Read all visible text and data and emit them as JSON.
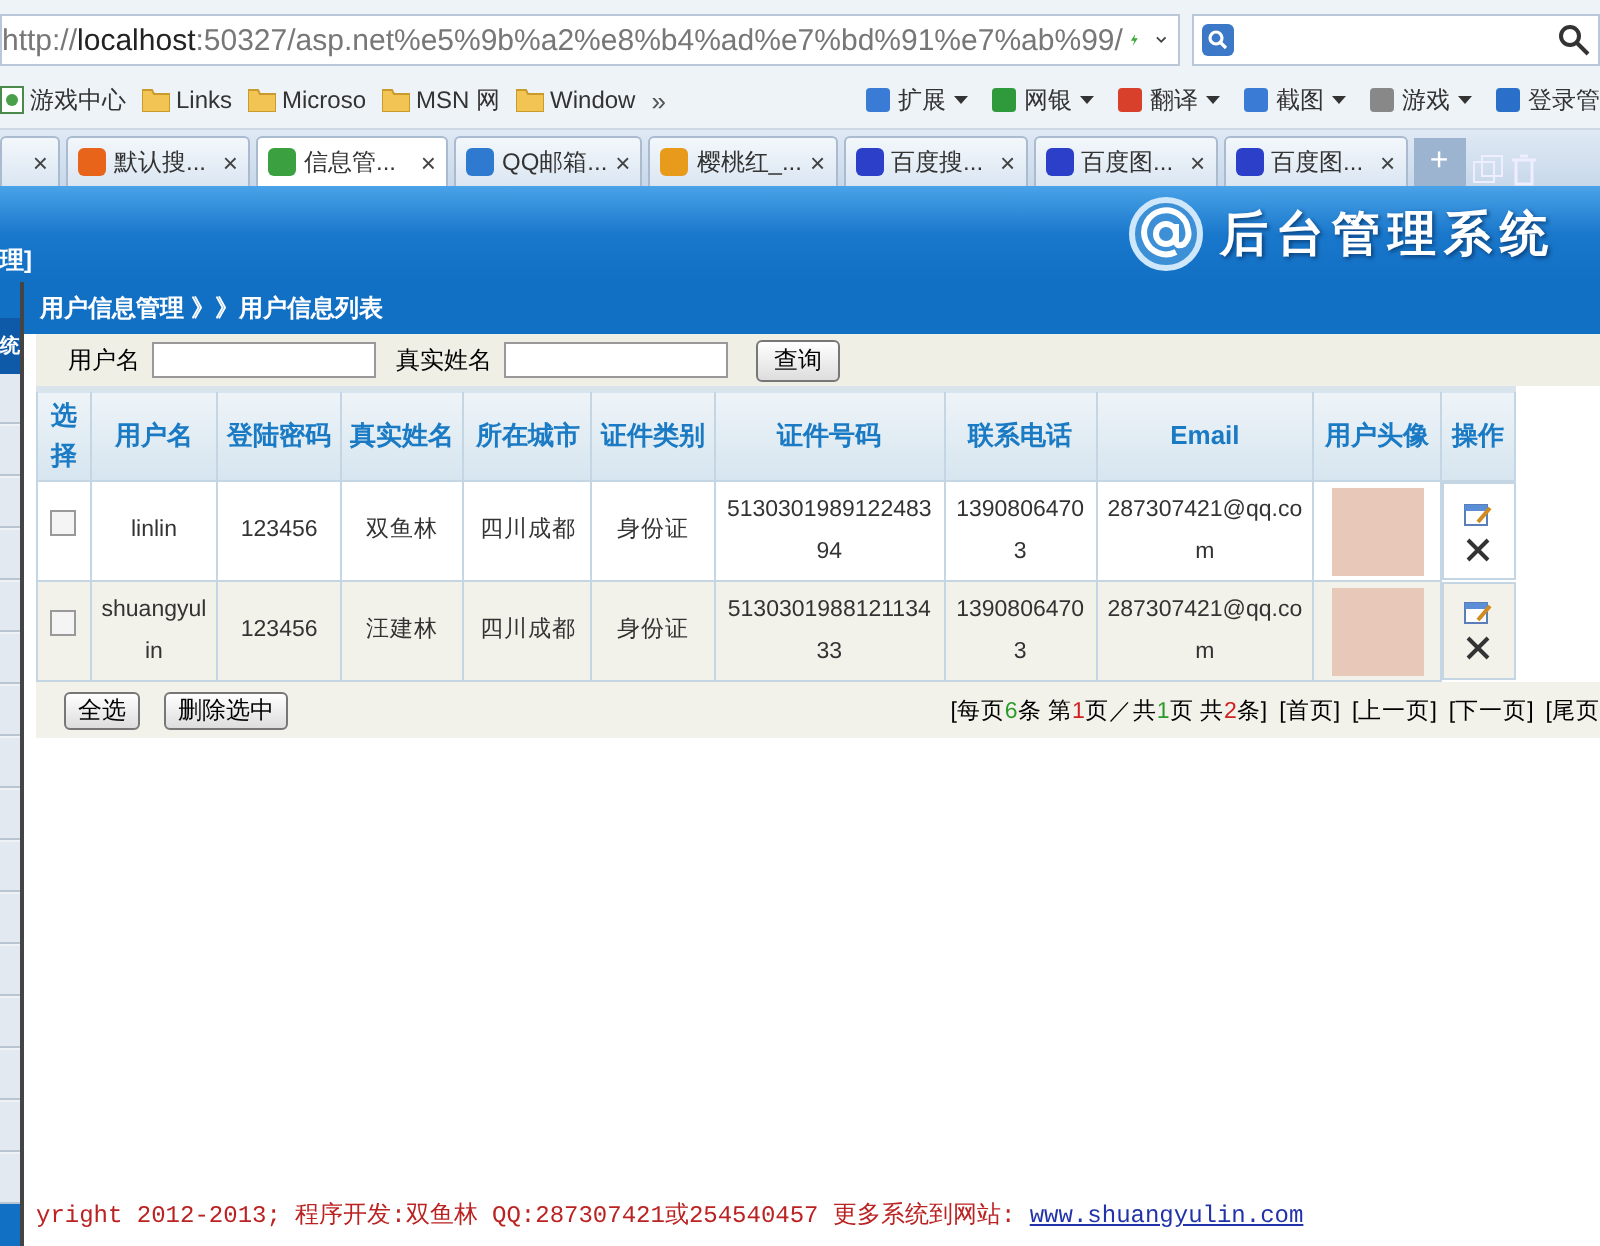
{
  "browser": {
    "address": {
      "scheme": "http://",
      "host": "localhost",
      "rest": ":50327/asp.net%e5%9b%a2%e8%b4%ad%e7%bd%91%e7%ab%99/"
    },
    "bookmarks": [
      {
        "label": "游戏中心",
        "kind": "page"
      },
      {
        "label": "Links",
        "kind": "folder"
      },
      {
        "label": "Microso",
        "kind": "folder"
      },
      {
        "label": "MSN 网",
        "kind": "folder"
      },
      {
        "label": "Window",
        "kind": "folder"
      }
    ],
    "more": "»",
    "tools": [
      {
        "label": "扩展",
        "color": "#3a7bd5"
      },
      {
        "label": "网银",
        "color": "#2e9a3c"
      },
      {
        "label": "翻译",
        "color": "#d9402b"
      },
      {
        "label": "截图",
        "color": "#3a7bd5"
      },
      {
        "label": "游戏",
        "color": "#888888"
      },
      {
        "label": "登录管",
        "color": "#2a6fc9"
      }
    ],
    "tabs": [
      {
        "close": "×",
        "selected": false
      },
      {
        "label": "默认搜...",
        "close": "×",
        "selected": false,
        "color": "#e8641b"
      },
      {
        "label": "信息管...",
        "close": "×",
        "selected": true,
        "color": "#3aa040"
      },
      {
        "label": "QQ邮箱...",
        "close": "×",
        "selected": false,
        "color": "#2e7ad1"
      },
      {
        "label": "樱桃红_...",
        "close": "×",
        "selected": false,
        "color": "#e89b1b"
      },
      {
        "label": "百度搜...",
        "close": "×",
        "selected": false,
        "color": "#2b3fc9"
      },
      {
        "label": "百度图...",
        "close": "×",
        "selected": false,
        "color": "#2b3fc9"
      },
      {
        "label": "百度图...",
        "close": "×",
        "selected": false,
        "color": "#2b3fc9"
      }
    ],
    "new_tab": "+"
  },
  "app": {
    "title": "后台管理系统",
    "side_top": "理]",
    "side_title": "统",
    "breadcrumb": "用户信息管理 》》用户信息列表",
    "search": {
      "fields": [
        {
          "label": "用户名"
        },
        {
          "label": "真实姓名"
        }
      ],
      "button": "查询"
    },
    "table": {
      "columns": [
        "选择",
        "用户名",
        "登陆密码",
        "真实姓名",
        "所在城市",
        "证件类别",
        "证件号码",
        "联系电话",
        "Email",
        "用户头像",
        "操作"
      ],
      "rows": [
        {
          "checked": false,
          "cells": [
            "",
            "linlin",
            "123456",
            "双鱼林",
            "四川成都",
            "身份证",
            "513030198912248394",
            "13908064703",
            "287307421@qq.com"
          ]
        },
        {
          "checked": false,
          "cells": [
            "",
            "shuangyulin",
            "123456",
            "汪建林",
            "四川成都",
            "身份证",
            "513030198812113433",
            "13908064703",
            "287307421@qq.com"
          ]
        }
      ]
    },
    "actions": [
      "全选",
      "删除选中"
    ],
    "pager": {
      "info": [
        {
          "text": "[每页",
          "kind": "plain"
        },
        {
          "text": "6",
          "kind": "green"
        },
        {
          "text": "条 第",
          "kind": "plain"
        },
        {
          "text": "1",
          "kind": "red"
        },
        {
          "text": "页／共",
          "kind": "plain"
        },
        {
          "text": "1",
          "kind": "green"
        },
        {
          "text": "页 共",
          "kind": "plain"
        },
        {
          "text": "2",
          "kind": "red"
        },
        {
          "text": "条]",
          "kind": "plain"
        }
      ],
      "links": [
        "[首页]",
        "[上一页]",
        "[下一页]",
        "[尾页"
      ]
    },
    "footer": {
      "text": "yright 2012-2013; 程序开发:双鱼林  QQ:287307421或254540457  更多系统到网站:",
      "link": "www.shuangyulin.com"
    }
  }
}
